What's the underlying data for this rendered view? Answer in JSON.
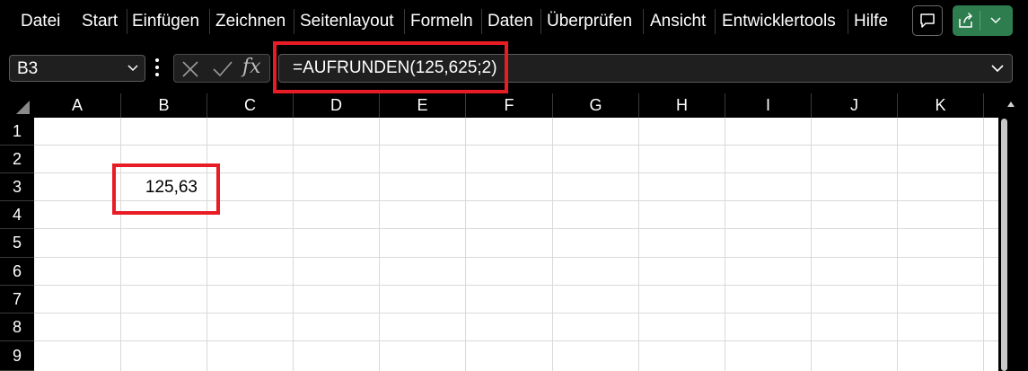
{
  "ribbon": {
    "tabs": [
      "Datei",
      "Start",
      "Einfügen",
      "Zeichnen",
      "Seitenlayout",
      "Formeln",
      "Daten",
      "Überprüfen",
      "Ansicht",
      "Entwicklertools",
      "Hilfe"
    ]
  },
  "icons": {
    "comments": "comment-icon",
    "share": "share-icon",
    "cancel": "cancel-x-icon",
    "enter": "checkmark-icon",
    "function": "fx-icon"
  },
  "formula_bar": {
    "name_box": "B3",
    "fx_label": "fx",
    "formula": "=AUFRUNDEN(125,625;2)"
  },
  "grid": {
    "columns": [
      "A",
      "B",
      "C",
      "D",
      "E",
      "F",
      "G",
      "H",
      "I",
      "J",
      "K"
    ],
    "rows": [
      "1",
      "2",
      "3",
      "4",
      "5",
      "6",
      "7",
      "8",
      "9"
    ],
    "cells": {
      "B3": "125,63"
    }
  },
  "colors": {
    "highlight": "#e81c24",
    "share_button": "#2e7d4f"
  }
}
